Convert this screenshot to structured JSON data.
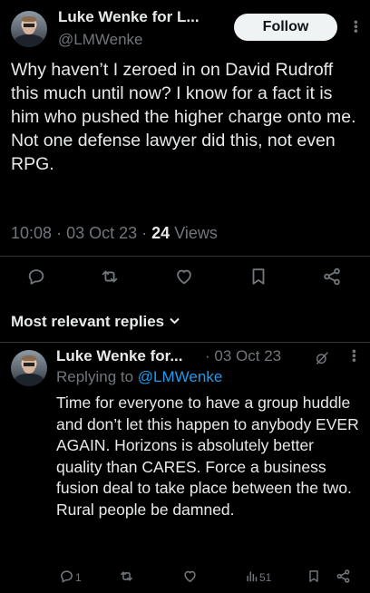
{
  "main_tweet": {
    "author_name": "Luke Wenke for L...",
    "author_handle": "@LMWenke",
    "follow_label": "Follow",
    "text": "Why haven’t I zeroed in on David Rudroff this much until now?  I know for a fact it is him who pushed the higher charge onto me.  Not one defense lawyer did this, not even RPG.",
    "time": "10:08",
    "date": "03 Oct 23",
    "views_count": "24",
    "views_label": "Views",
    "separator": "·"
  },
  "actions": {
    "icons": [
      "reply-icon",
      "retweet-icon",
      "like-icon",
      "bookmark-icon",
      "share-icon"
    ]
  },
  "replies_header": {
    "label": "Most relevant replies"
  },
  "reply": {
    "author_name": "Luke Wenke for...",
    "date": "03 Oct 23",
    "separator": "·",
    "replying_prefix": "Replying to",
    "replying_to": "@LMWenke",
    "text": "Time for everyone to have a group huddle and don’t let this happen to anybody EVER AGAIN.  Horizons is absolutely better quality than CARES.  Force a business fusion deal to take place between the two. Rural people be damned.",
    "reply_count": "1",
    "views_count": "51"
  },
  "colors": {
    "background": "#000000",
    "text_primary": "#e7e9ea",
    "text_secondary": "#71767b",
    "link": "#1d9bf0",
    "divider": "#2f3336"
  }
}
